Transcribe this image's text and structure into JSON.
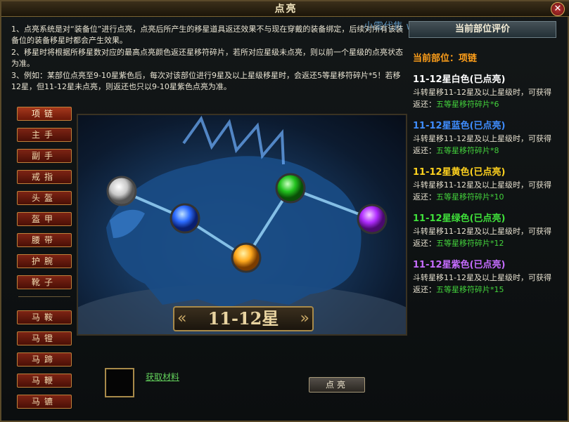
{
  "window": {
    "title": "点亮",
    "close_label": "✕"
  },
  "watermark": "小雷代售 www.xx.....com",
  "intro": [
    "1、点亮系统是对“装备位”进行点亮，点亮后所产生的移星道具返还效果不与现在穿戴的装备绑定，后续对所有该装备位的装备移星时都会产生效果。",
    "2、移星时将根据所移星数对应的最高点亮颜色返还星移符碎片，若所对应星级未点亮，则以前一个星级的点亮状态为准。",
    "3、例如：某部位点亮至9-10星紫色后，每次对该部位进行9星及以上星级移星时，会返还5等星移符碎片*5！若移12星，但11-12星未点亮，则返还也只以9-10星紫色点亮为准。"
  ],
  "sidebar": {
    "items": [
      {
        "label": "项链"
      },
      {
        "label": "主手"
      },
      {
        "label": "副手"
      },
      {
        "label": "戒指"
      },
      {
        "label": "头盔"
      },
      {
        "label": "盔甲"
      },
      {
        "label": "腰带"
      },
      {
        "label": "护腕"
      },
      {
        "label": "靴子"
      },
      {
        "label": "马鞍"
      },
      {
        "label": "马镫"
      },
      {
        "label": "马蹄"
      },
      {
        "label": "马鞭"
      },
      {
        "label": "马镳"
      }
    ]
  },
  "scene": {
    "star_range": "11-12星",
    "orbs": [
      "white",
      "blue",
      "orange",
      "green",
      "purple"
    ]
  },
  "bottom": {
    "get_materials": "获取材料",
    "light_button": "点亮"
  },
  "panel": {
    "header": "当前部位评价",
    "current_part": "当前部位：项链",
    "tiers": [
      {
        "title": "11-12星白色(已点亮)",
        "color": "#ffffff",
        "desc": "斗转星移11-12星及以上星级时，可获得返还：",
        "reward": "五等星移符碎片*6"
      },
      {
        "title": "11-12星蓝色(已点亮)",
        "color": "#3f8dff",
        "desc": "斗转星移11-12星及以上星级时，可获得返还：",
        "reward": "五等星移符碎片*8"
      },
      {
        "title": "11-12星黄色(已点亮)",
        "color": "#ffd21e",
        "desc": "斗转星移11-12星及以上星级时，可获得返还：",
        "reward": "五等星移符碎片*10"
      },
      {
        "title": "11-12星绿色(已点亮)",
        "color": "#3fe03a",
        "desc": "斗转星移11-12星及以上星级时，可获得返还：",
        "reward": "五等星移符碎片*12"
      },
      {
        "title": "11-12星紫色(已点亮)",
        "color": "#c56cff",
        "desc": "斗转星移11-12星及以上星级时，可获得返还：",
        "reward": "五等星移符碎片*15"
      }
    ]
  }
}
